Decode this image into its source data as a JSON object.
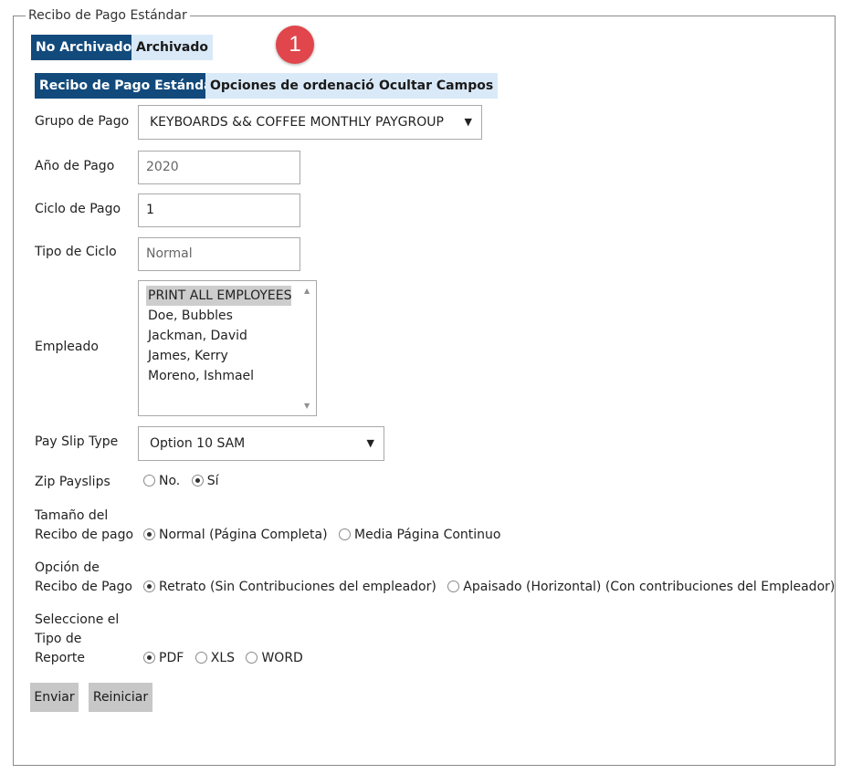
{
  "form": {
    "legend": "Recibo de Pago Estándar"
  },
  "archive_tabs": [
    "No Archivado",
    "Archivado"
  ],
  "badge_number": "1",
  "section_tabs": [
    "Recibo de Pago Estándar",
    "Opciones de ordenación",
    "Ocultar Campos"
  ],
  "fields": {
    "pay_group": {
      "label": "Grupo de Pago",
      "value": "KEYBOARDS && COFFEE MONTHLY PAYGROUP"
    },
    "pay_year": {
      "label": "Año de Pago",
      "placeholder": "2020"
    },
    "pay_cycle": {
      "label": "Ciclo de Pago",
      "value": "1"
    },
    "cycle_type": {
      "label": "Tipo de Ciclo",
      "placeholder": "Normal"
    },
    "employee": {
      "label": "Empleado",
      "options": [
        "PRINT ALL EMPLOYEES",
        "Doe, Bubbles",
        "Jackman, David",
        "James, Kerry",
        "Moreno, Ishmael"
      ],
      "selected": "PRINT ALL EMPLOYEES"
    },
    "pay_slip_type": {
      "label": "Pay Slip Type",
      "value": "Option 10 SAM"
    },
    "zip_payslips": {
      "label": "Zip Payslips",
      "options": [
        "No.",
        "Sí"
      ],
      "selected": "Sí"
    },
    "receipt_size": {
      "label_line1": "Tamaño del",
      "label_line2": "Recibo de pago",
      "options": [
        "Normal (Página Completa)",
        "Media Página Continuo"
      ],
      "selected": "Normal (Página Completa)"
    },
    "receipt_option": {
      "label_line1": "Opción de",
      "label_line2": "Recibo de Pago",
      "options": [
        "Retrato (Sin Contribuciones del empleador)",
        "Apaisado (Horizontal) (Con contribuciones del Empleador)"
      ],
      "selected": "Retrato (Sin Contribuciones del empleador)"
    },
    "report_type": {
      "label_line1": "Seleccione el",
      "label_line2": "Tipo de",
      "label_line3": "Reporte",
      "options": [
        "PDF",
        "XLS",
        "WORD"
      ],
      "selected": "PDF"
    }
  },
  "actions": {
    "submit": "Enviar",
    "reset": "Reiniciar"
  },
  "colors": {
    "active_tab": "#124a7c",
    "inactive_tab": "#d9e9f7",
    "badge": "#e0464b",
    "button": "#c7c7c7"
  }
}
